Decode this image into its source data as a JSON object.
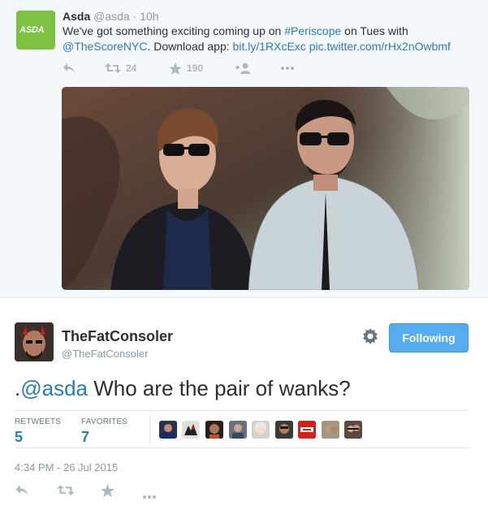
{
  "quoted_tweet": {
    "avatar_text": "ASDA",
    "name": "Asda",
    "handle": "@asda",
    "separator": "·",
    "time": "10h",
    "text_1": "We've got something exciting coming up on ",
    "hashtag": "#Periscope",
    "text_2": " on Tues with",
    "mention": "@TheScoreNYC",
    "text_3": ". Download app: ",
    "link_1": "bit.ly/1RXcExc",
    "text_4": " ",
    "link_2": "pic.twitter.com/rHx2nOwbmf",
    "retweet_count": "24",
    "favorite_count": "190"
  },
  "tweet": {
    "name": "TheFatConsoler",
    "handle": "@TheFatConsoler",
    "follow_label": "Following",
    "text_prefix": ".",
    "text_mention": "@asda",
    "text_body": " Who are the pair of wanks?",
    "retweets_label": "RETWEETS",
    "retweets_value": "5",
    "favorites_label": "FAVORITES",
    "favorites_value": "7",
    "timestamp": "4:34 PM - 26 Jul 2015"
  },
  "colors": {
    "link": "#2b7bb9",
    "follow_button": "#55acee",
    "brand_green": "#7dc242",
    "muted": "#8899a6"
  },
  "icons": [
    "reply-icon",
    "retweet-icon",
    "favorite-icon",
    "follow-icon",
    "more-icon",
    "gear-icon"
  ]
}
